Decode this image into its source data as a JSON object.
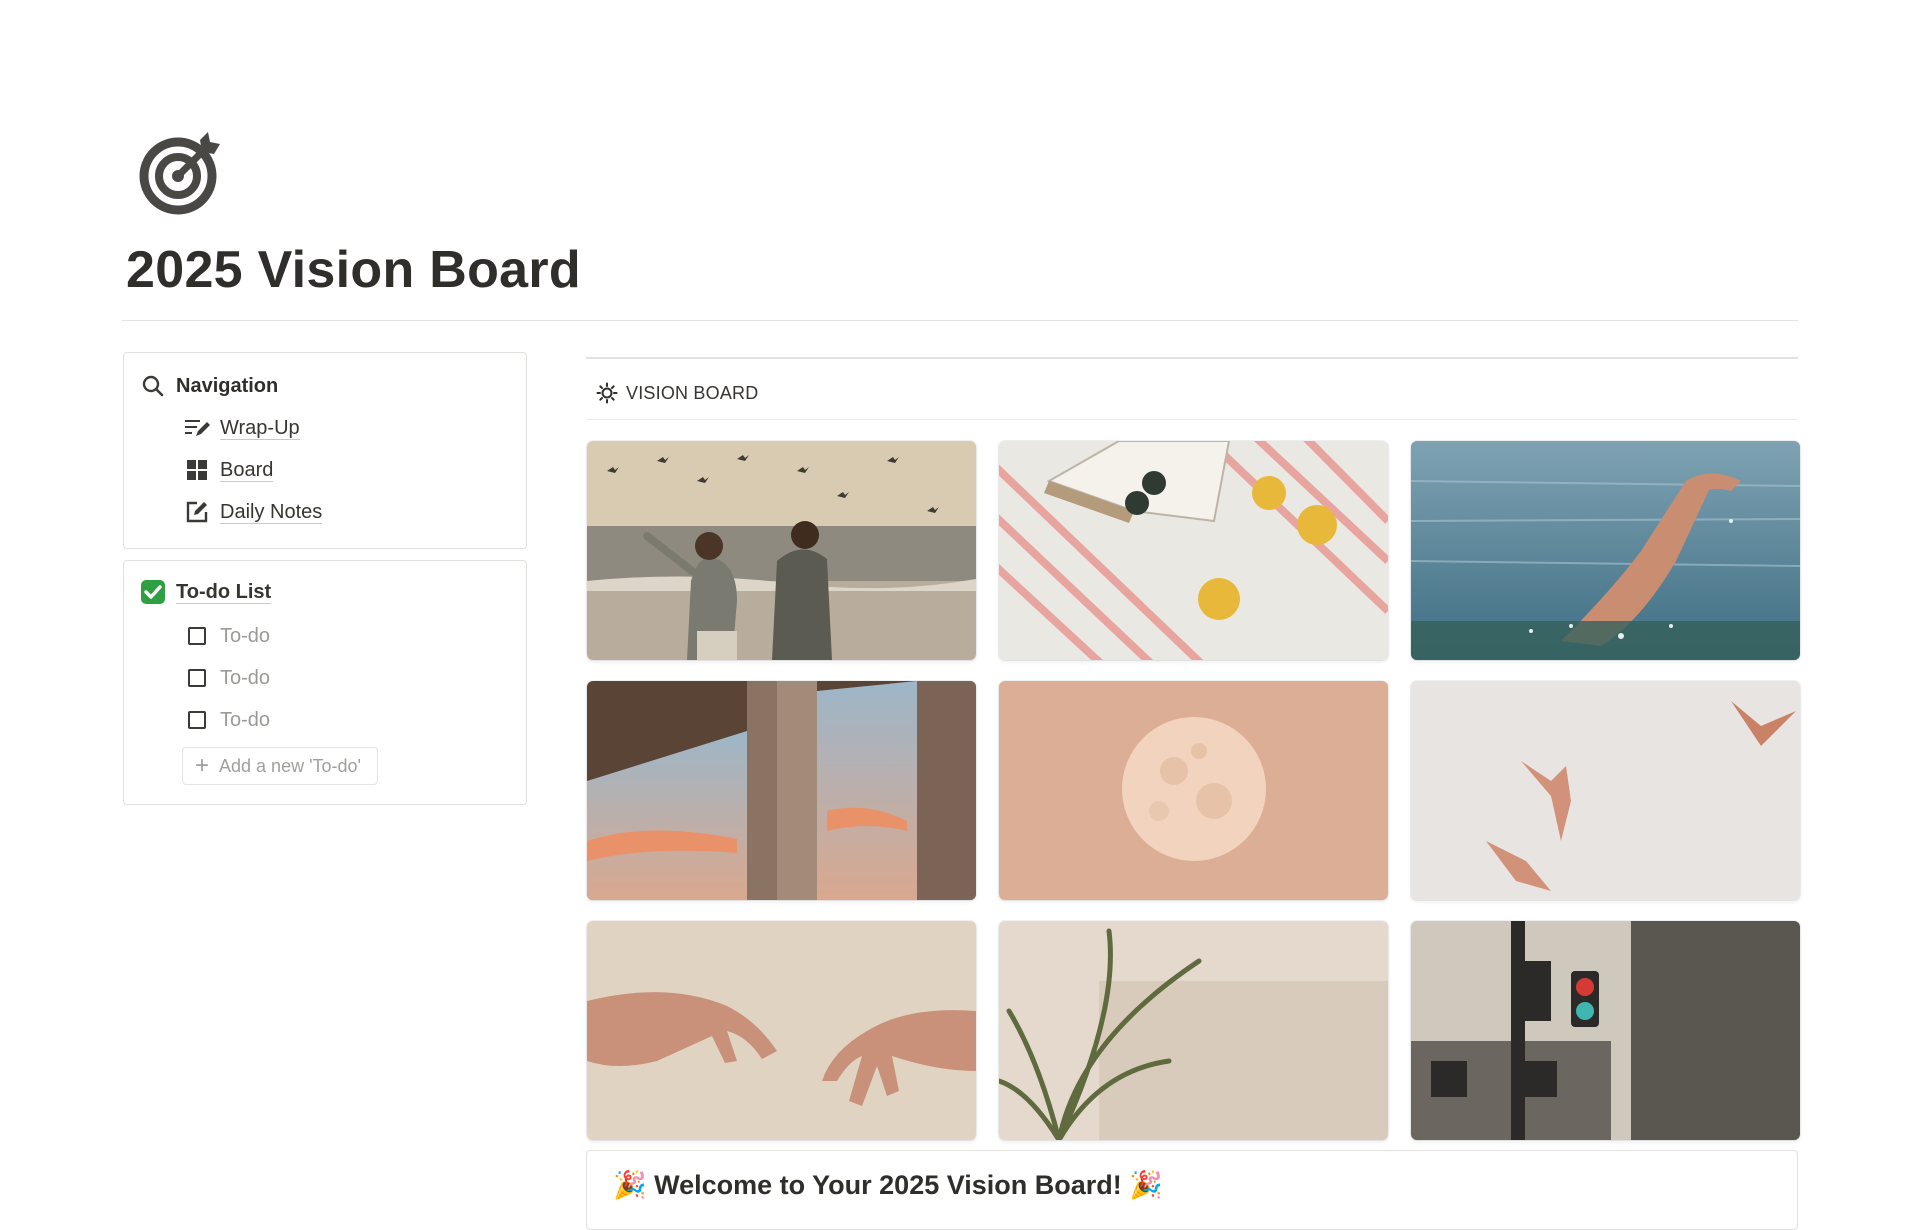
{
  "page": {
    "title": "2025 Vision Board",
    "icon": "target-icon"
  },
  "navigation": {
    "heading": "Navigation",
    "heading_icon": "search-icon",
    "links": [
      {
        "label": "Wrap-Up",
        "icon": "edit-list-icon"
      },
      {
        "label": "Board",
        "icon": "grid-icon"
      },
      {
        "label": "Daily Notes",
        "icon": "edit-note-icon"
      }
    ]
  },
  "todo": {
    "heading": "To-do List",
    "heading_icon": "checkmark-icon",
    "items": [
      {
        "label": "To-do",
        "checked": false
      },
      {
        "label": "To-do",
        "checked": false
      },
      {
        "label": "To-do",
        "checked": false
      }
    ],
    "add_label": "Add a new 'To-do'"
  },
  "vision_board": {
    "heading": "VISION BOARD",
    "heading_icon": "sun-icon",
    "images": [
      {
        "name": "couple-beach-seagulls-image"
      },
      {
        "name": "book-sunglasses-lemons-image"
      },
      {
        "name": "legs-diving-water-image"
      },
      {
        "name": "sunset-window-image"
      },
      {
        "name": "full-moon-image"
      },
      {
        "name": "seagulls-flying-image"
      },
      {
        "name": "reaching-hands-image"
      },
      {
        "name": "palm-shadow-wall-image"
      },
      {
        "name": "traffic-light-image"
      }
    ]
  },
  "welcome": {
    "title": "🎉 Welcome to Your 2025 Vision Board! 🎉"
  },
  "colors": {
    "text": "#37352f",
    "muted": "#9b9a97",
    "border": "#e2e1de",
    "check_green": "#2ea043"
  }
}
